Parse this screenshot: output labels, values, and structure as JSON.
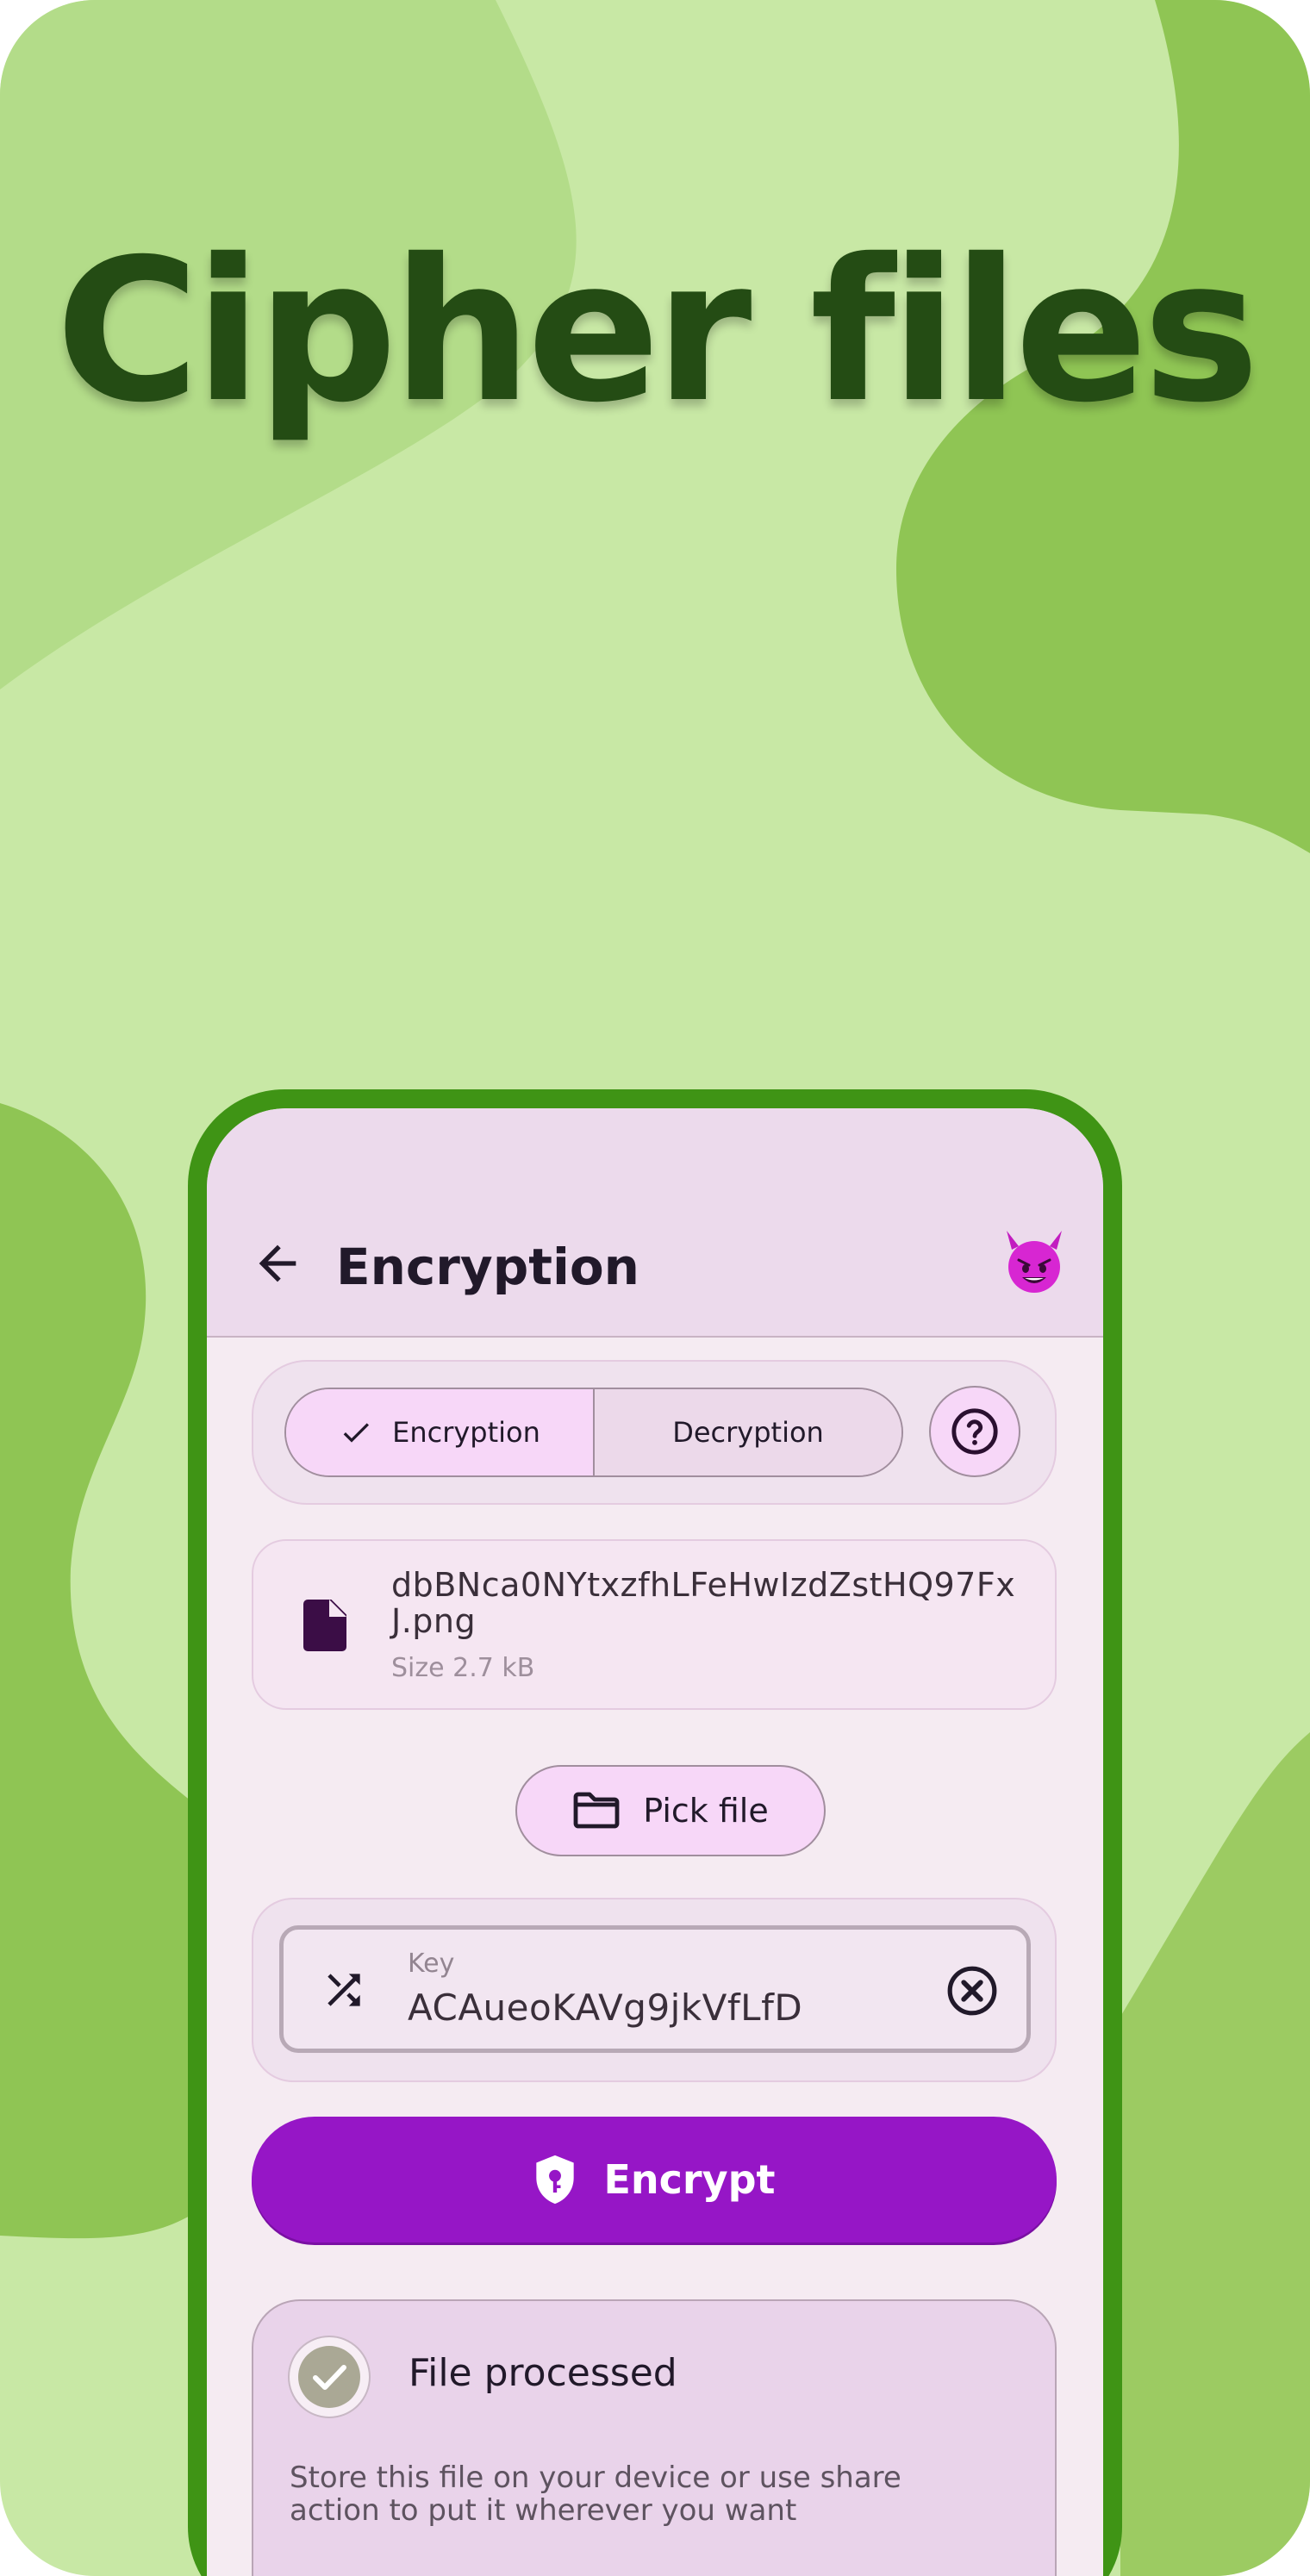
{
  "headline": "Cipher files",
  "colors": {
    "background": "#c8e8a5",
    "blob_light": "#b3dc89",
    "blob_dark": "#8fc554",
    "headline": "#244c14",
    "phone_frame": "#3f9415",
    "accent": "#9616c6"
  },
  "app": {
    "title": "Encryption",
    "back_icon": "arrow-left-icon",
    "avatar_icon": "smiling-devil-emoji",
    "mode": {
      "options": [
        "Encryption",
        "Decryption"
      ],
      "selected": "Encryption",
      "help_icon": "question-circle-icon"
    },
    "file": {
      "name": "dbBNca0NYtxzfhLFeHwIzdZstHQ97FxJ.png",
      "size": "Size 2.7 kB",
      "icon": "file-icon"
    },
    "pick_file": {
      "label": "Pick file",
      "icon": "folder-icon"
    },
    "key": {
      "label": "Key",
      "value": "ACAueoKAVg9jkVfLfD",
      "leading_icon": "shuffle-icon",
      "trailing_icon": "clear-circle-icon"
    },
    "encrypt_button": {
      "label": "Encrypt",
      "icon": "shield-key-icon"
    },
    "result": {
      "title": "File processed",
      "description": "Store this file on your device or use share action to put it wherever you want",
      "icon": "check-icon"
    }
  }
}
